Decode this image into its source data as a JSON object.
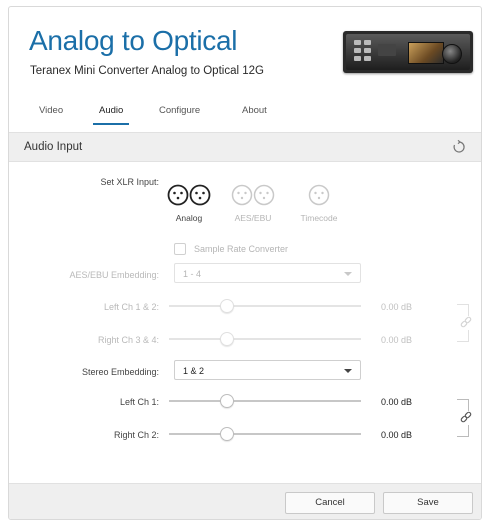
{
  "header": {
    "title": "Analog to Optical",
    "subtitle": "Teranex Mini Converter Analog to Optical 12G"
  },
  "tabs": [
    {
      "label": "Video",
      "active": false
    },
    {
      "label": "Audio",
      "active": true
    },
    {
      "label": "Configure",
      "active": false
    },
    {
      "label": "About",
      "active": false
    }
  ],
  "section": {
    "title": "Audio Input"
  },
  "xlr_input": {
    "label": "Set XLR Input:",
    "options": [
      {
        "label": "Analog",
        "selected": true,
        "enabled": true,
        "icon": "dual-xlr-icon"
      },
      {
        "label": "AES/EBU",
        "selected": false,
        "enabled": false,
        "icon": "dual-xlr-icon"
      },
      {
        "label": "Timecode",
        "selected": false,
        "enabled": false,
        "icon": "single-xlr-icon"
      }
    ]
  },
  "sample_rate_converter": {
    "label": "Sample Rate Converter",
    "checked": false,
    "enabled": false
  },
  "aes_embedding": {
    "label": "AES/EBU Embedding:",
    "value": "1 - 4",
    "enabled": false,
    "channels": [
      {
        "label": "Left Ch 1 & 2:",
        "value": "0.00 dB",
        "level": 0.3
      },
      {
        "label": "Right Ch 3 & 4:",
        "value": "0.00 dB",
        "level": 0.3
      }
    ]
  },
  "stereo_embedding": {
    "label": "Stereo Embedding:",
    "value": "1 & 2",
    "enabled": true,
    "channels": [
      {
        "label": "Left Ch 1:",
        "value": "0.00 dB",
        "level": 0.3
      },
      {
        "label": "Right Ch 2:",
        "value": "0.00 dB",
        "level": 0.3
      }
    ]
  },
  "footer": {
    "cancel_label": "Cancel",
    "save_label": "Save"
  },
  "colors": {
    "accent": "#1b6fa8",
    "panel": "#efefef",
    "disabled_text": "#b9b9b9"
  }
}
